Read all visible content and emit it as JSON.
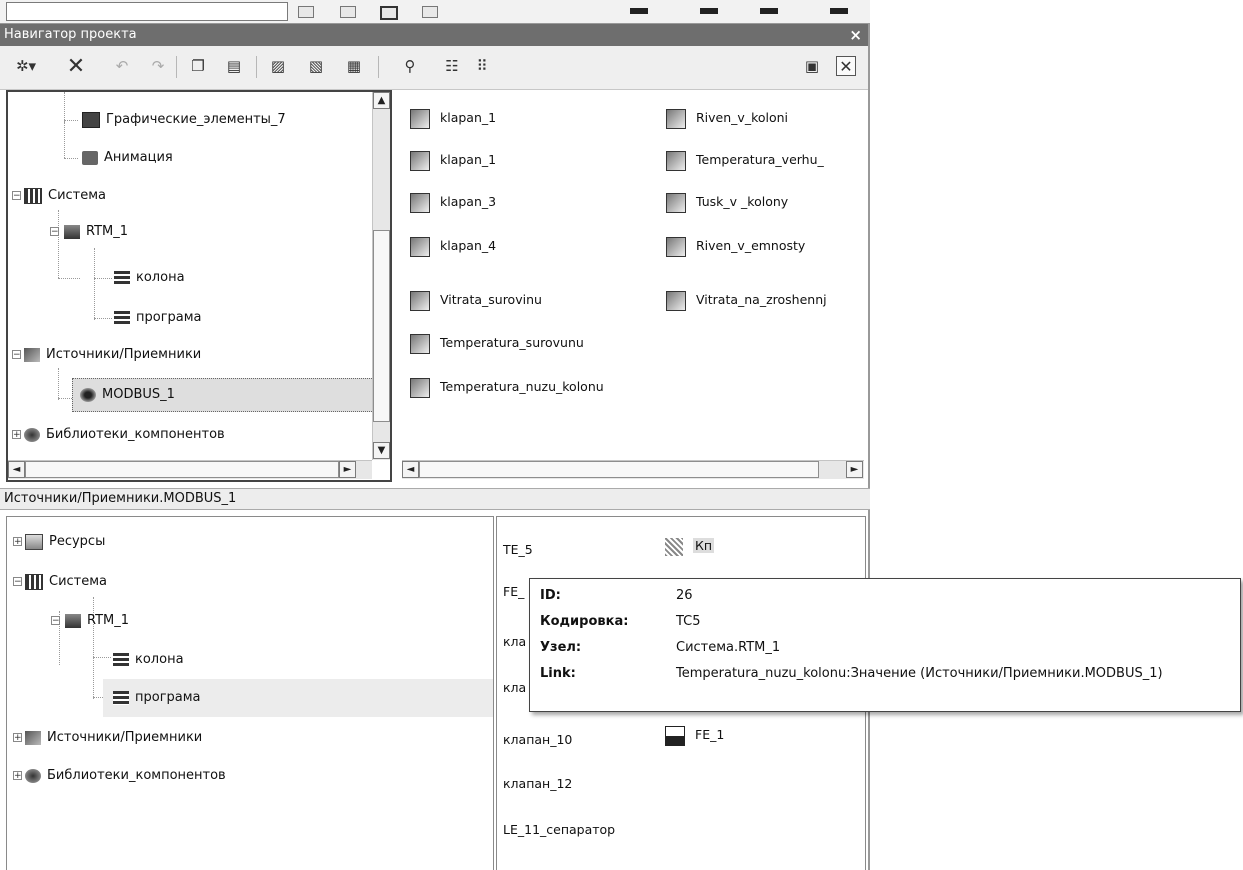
{
  "window": {
    "title": "Навигатор проекта",
    "close_glyph": "×"
  },
  "toolbar": {
    "icons": [
      "new-item-icon",
      "delete-icon",
      "undo-icon",
      "redo-icon",
      "copy-icon",
      "paste-icon",
      "cut-icon",
      "paste-special-icon",
      "properties-icon",
      "find-icon",
      "tree-view-icon",
      "list-view-icon",
      "panel-settings-icon",
      "close-panel-icon"
    ]
  },
  "top_tree": {
    "items": [
      {
        "label": "Графические_элементы_7",
        "icon": "graphics-icon"
      },
      {
        "label": "Анимация",
        "icon": "animation-icon"
      },
      {
        "label": "Система",
        "icon": "system-icon"
      },
      {
        "label": "RTM_1",
        "icon": "rtm-node-icon"
      },
      {
        "label": "колона",
        "icon": "program-icon"
      },
      {
        "label": "програма",
        "icon": "program-icon"
      },
      {
        "label": "Источники/Приемники",
        "icon": "sources-icon"
      },
      {
        "label": "MODBUS_1",
        "icon": "modbus-icon"
      },
      {
        "label": "Библиотеки_компонентов",
        "icon": "library-icon"
      }
    ]
  },
  "top_list": {
    "col1": [
      "klapan_1",
      "klapan_1",
      "klapan_3",
      "klapan_4",
      "Vitrata_surovinu",
      "Temperatura_surovunu",
      "Temperatura_nuzu_kolonu"
    ],
    "col2": [
      "Riven_v_koloni",
      "Temperatura_verhu_",
      "Tusk_v _kolony",
      "Riven_v_emnosty",
      "Vitrata_na_zroshennj"
    ]
  },
  "path_bar": "Источники/Приемники.MODBUS_1",
  "bottom_tree": {
    "items": [
      {
        "label": "Ресурсы",
        "icon": "resources-icon"
      },
      {
        "label": "Система",
        "icon": "system-icon"
      },
      {
        "label": "RTM_1",
        "icon": "rtm-node-icon"
      },
      {
        "label": "колона",
        "icon": "program-icon"
      },
      {
        "label": "програма",
        "icon": "program-icon"
      },
      {
        "label": "Источники/Приемники",
        "icon": "sources-icon"
      },
      {
        "label": "Библиотеки_компонентов",
        "icon": "library-icon"
      }
    ]
  },
  "bottom_list": {
    "col1": [
      "TE_5",
      "FE_",
      "кла",
      "кла",
      "клапан_10",
      "клапан_12",
      "LE_11_сепаратор"
    ],
    "col2": [
      "Кп",
      "FE_1"
    ]
  },
  "tooltip": {
    "rows": [
      {
        "key": "ID:",
        "value": "26"
      },
      {
        "key": "Кодировка:",
        "value": "TC5"
      },
      {
        "key": "Узел:",
        "value": "Система.RTM_1"
      },
      {
        "key": "Link:",
        "value": "Temperatura_nuzu_kolonu:Значение (Источники/Приемники.MODBUS_1)"
      }
    ]
  },
  "scroll": {
    "up": "▲",
    "down": "▼",
    "left": "◄",
    "right": "►"
  }
}
